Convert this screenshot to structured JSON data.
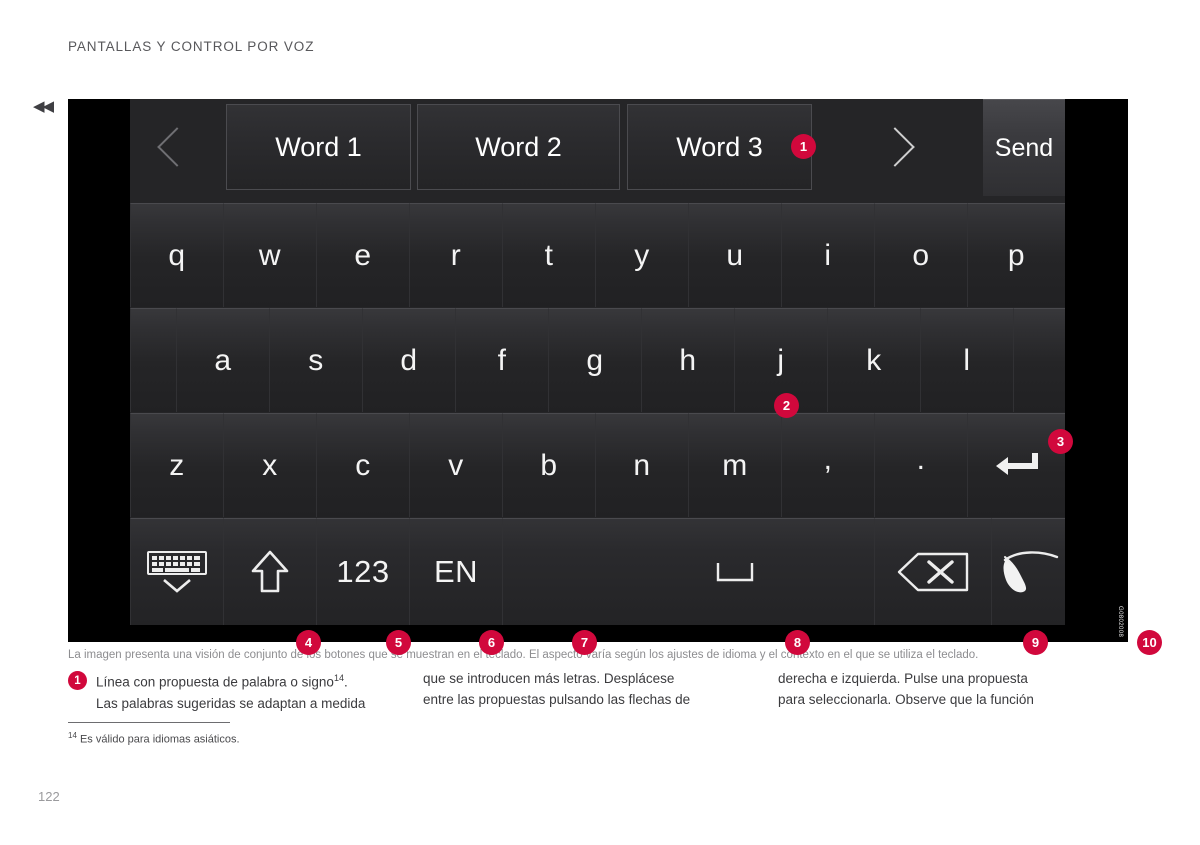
{
  "page": {
    "header": "PANTALLAS Y CONTROL POR VOZ",
    "number": "122",
    "back_marker": "◀◀",
    "image_id": "G0802008"
  },
  "colors": {
    "badge": "#d1083c",
    "panel": "#252527",
    "bezel": "#000000",
    "key_text": "#f4f4f4"
  },
  "keyboard": {
    "suggestions": {
      "prev_label": "chevron-left",
      "next_label": "chevron-right",
      "items": [
        "Word 1",
        "Word 2",
        "Word 3"
      ],
      "send_label": "Send"
    },
    "row1": [
      "q",
      "w",
      "e",
      "r",
      "t",
      "y",
      "u",
      "i",
      "o",
      "p"
    ],
    "row2": [
      "a",
      "s",
      "d",
      "f",
      "g",
      "h",
      "j",
      "k",
      "l"
    ],
    "row3": [
      "z",
      "x",
      "c",
      "v",
      "b",
      "n",
      "m",
      ",",
      ".",
      "enter"
    ],
    "function_row": [
      {
        "name": "hide-keyboard",
        "label": "",
        "icon": "keyboard-down-icon"
      },
      {
        "name": "shift",
        "label": "",
        "icon": "shift-up-arrow-icon"
      },
      {
        "name": "numbers",
        "label": "123",
        "icon": ""
      },
      {
        "name": "language",
        "label": "EN",
        "icon": ""
      },
      {
        "name": "space",
        "label": "",
        "icon": "space-bar-icon"
      },
      {
        "name": "backspace",
        "label": "",
        "icon": "backspace-delete-icon"
      },
      {
        "name": "handwriting",
        "label": "",
        "icon": "handwriting-stylus-icon"
      }
    ]
  },
  "callouts": {
    "c1": "1",
    "c2": "2",
    "c3": "3",
    "c4": "4",
    "c5": "5",
    "c6": "6",
    "c7": "7",
    "c8": "8",
    "c9": "9",
    "c10": "10"
  },
  "caption": "La imagen presenta una visión de conjunto de los botones que se muestran en el teclado. El aspecto varía según los ajustes de idioma y el contexto en el que se utiliza el teclado.",
  "legend": {
    "badge": "1",
    "col1_line1": "Línea con propuesta de palabra o signo",
    "col1_sup": "14",
    "col1_line1_end": ".",
    "col1_line2": "Las palabras sugeridas se adaptan a medida",
    "col2_line1": "que se introducen más letras. Desplácese",
    "col2_line2": "entre las propuestas pulsando las flechas de",
    "col3_line1": "derecha e izquierda. Pulse una propuesta",
    "col3_line2": "para seleccionarla. Observe que la función"
  },
  "footnote": {
    "marker": "14",
    "text": "Es válido para idiomas asiáticos."
  }
}
